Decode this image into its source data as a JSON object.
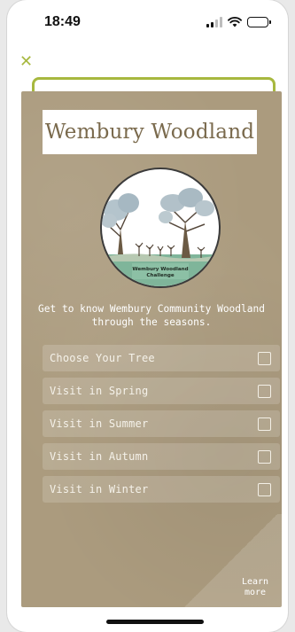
{
  "status_bar": {
    "time": "18:49",
    "icons": [
      "signal-icon",
      "wifi-icon",
      "battery-icon"
    ]
  },
  "nav": {
    "close_icon": "close-icon",
    "close_glyph": "✕"
  },
  "card": {
    "title": "Wembury Woodland",
    "logo": {
      "name": "wembury-woodland-challenge-logo",
      "caption_line1": "Wembury Woodland",
      "caption_line2": "Challenge"
    },
    "intro": "Get to know Wembury Community Woodland through the seasons.",
    "checklist": [
      {
        "label": "Choose Your Tree",
        "checked": false
      },
      {
        "label": "Visit in Spring",
        "checked": false
      },
      {
        "label": "Visit in Summer",
        "checked": false
      },
      {
        "label": "Visit in Autumn",
        "checked": false
      },
      {
        "label": "Visit in Winter",
        "checked": false
      }
    ],
    "learn_more": "Learn more"
  },
  "colors": {
    "accent": "#a7b83f",
    "panel": "#ab9b7e",
    "title_text": "#7a6a4d",
    "logo_ground": "#7fb59a"
  }
}
